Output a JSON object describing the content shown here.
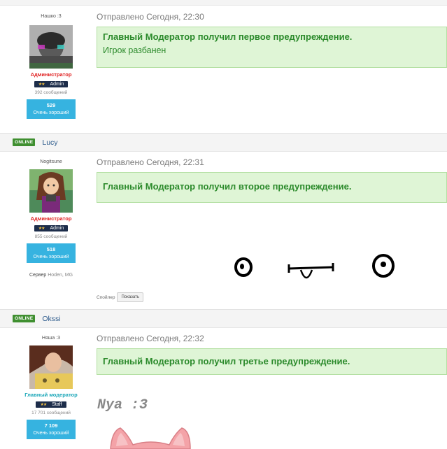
{
  "posts": [
    {
      "user_title": "Нашко :3",
      "role": "Администратор",
      "rank": "Admin",
      "messages": "392 сообщений",
      "rep_value": "529",
      "rep_label": "Очень хороший",
      "sent": "Отправлено Сегодня, 22:30",
      "notice": "Главный Модератор получил первое предупреждение.",
      "notice_sub": "Игрок разбанен"
    },
    {
      "online": "ONLINE",
      "nick": "Lucy",
      "user_title": "Nogitsune",
      "role": "Администратор",
      "rank": "Admin",
      "messages": "855 сообщений",
      "rep_value": "518",
      "rep_label": "Очень хороший",
      "server_label": "Сервер",
      "server_value": "Hoden, MG",
      "sent": "Отправлено Сегодня, 22:31",
      "notice": "Главный Модератор получил второе предупреждение.",
      "spoiler_label": "Спойлер",
      "spoiler_button": "Показать"
    },
    {
      "online": "ONLINE",
      "nick": "Okssi",
      "user_title": "Няша :3",
      "role": "Главный модератор",
      "rank": "Staff",
      "messages": "17 701 сообщений",
      "rep_value": "7 109",
      "rep_label": "Очень хороший",
      "sent": "Отправлено Сегодня, 22:32",
      "notice": "Главный Модератор получил третье предупреждение.",
      "image_text": "Nya :3"
    }
  ],
  "colors": {
    "online_badge": "#3f8f30",
    "admin_role": "#e02020",
    "gmod_role": "#19a6b8",
    "rep_box": "#36b3e0",
    "notice_bg": "#dff5d6",
    "notice_text": "#2b8a2b"
  }
}
